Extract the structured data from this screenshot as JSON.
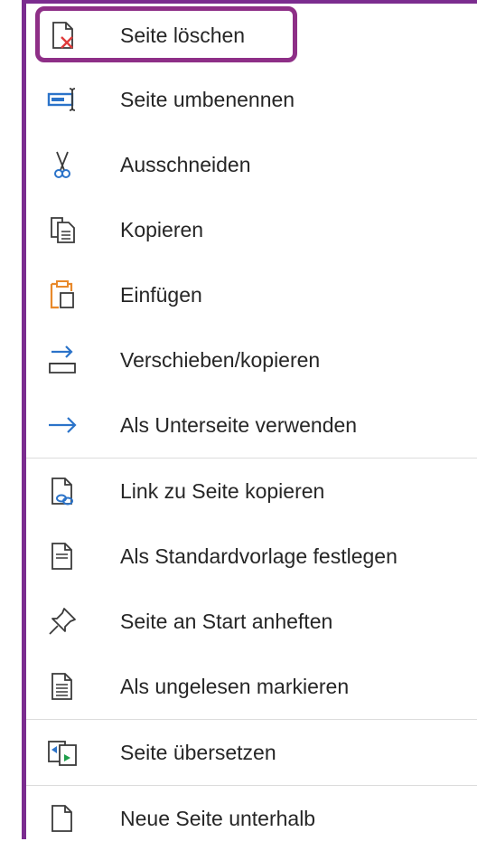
{
  "menu": {
    "items": [
      {
        "label": "Seite löschen",
        "icon": "delete-page-icon"
      },
      {
        "label": "Seite umbenennen",
        "icon": "rename-icon"
      },
      {
        "label": "Ausschneiden",
        "icon": "scissors-icon"
      },
      {
        "label": "Kopieren",
        "icon": "copy-icon"
      },
      {
        "label": "Einfügen",
        "icon": "paste-icon"
      },
      {
        "label": "Verschieben/kopieren",
        "icon": "move-copy-icon"
      },
      {
        "label": "Als Unterseite verwenden",
        "icon": "arrow-right-icon"
      },
      {
        "label": "Link zu Seite kopieren",
        "icon": "link-page-icon"
      },
      {
        "label": "Als Standardvorlage festlegen",
        "icon": "template-icon"
      },
      {
        "label": "Seite an Start anheften",
        "icon": "pin-icon"
      },
      {
        "label": "Als ungelesen markieren",
        "icon": "unread-page-icon"
      },
      {
        "label": "Seite übersetzen",
        "icon": "translate-icon"
      },
      {
        "label": "Neue Seite unterhalb",
        "icon": "new-page-icon"
      }
    ]
  },
  "colors": {
    "frame": "#7B2C8F",
    "highlight": "#8E2F87",
    "blue": "#2B73C9",
    "orange": "#E8892B",
    "red": "#E03B3B",
    "green": "#1E9E4A",
    "gray_icon": "#3a3a3a"
  }
}
